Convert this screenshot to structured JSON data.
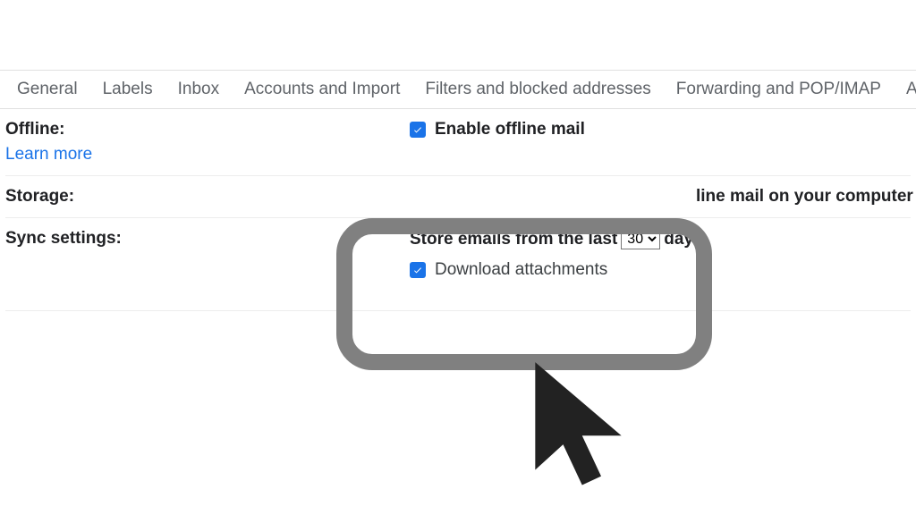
{
  "tabs": {
    "general": "General",
    "labels": "Labels",
    "inbox": "Inbox",
    "accounts": "Accounts and Import",
    "filters": "Filters and blocked addresses",
    "forwarding": "Forwarding and POP/IMAP",
    "more": "A"
  },
  "offline": {
    "label": "Offline:",
    "learn_more": "Learn more",
    "enable_label": "Enable offline mail"
  },
  "storage": {
    "label": "Storage:",
    "text_fragment": "line mail on your computer"
  },
  "sync": {
    "label": "Sync settings:",
    "store_prefix": "Store emails from the last",
    "store_suffix": "days.",
    "days_value": "30",
    "download_label": "Download attachments"
  }
}
